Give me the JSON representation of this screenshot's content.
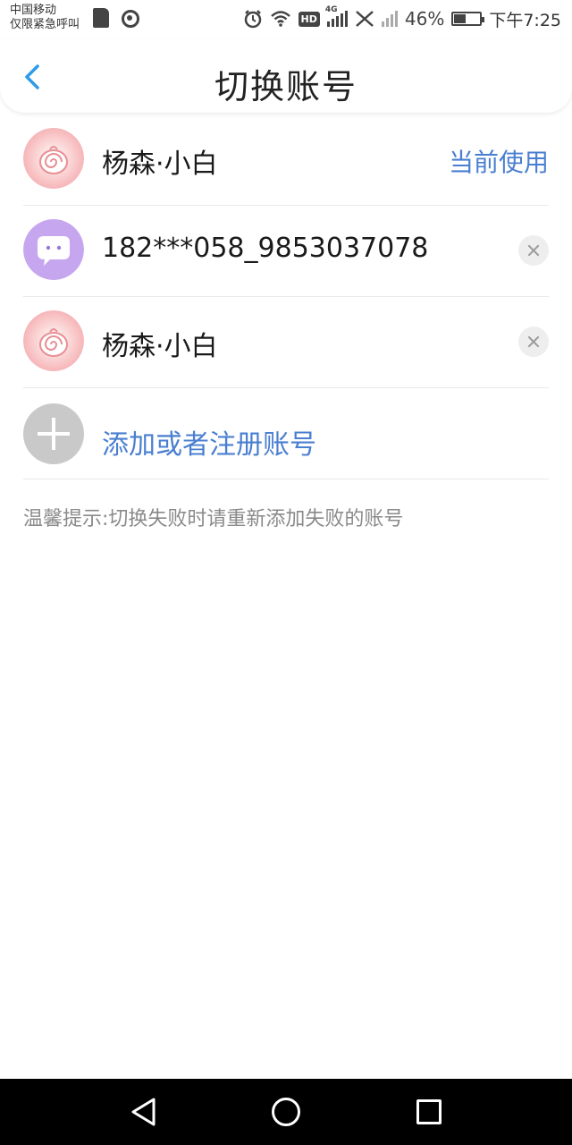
{
  "status_bar": {
    "carrier_line1": "中国移动",
    "carrier_line2": "仅限紧急呼叫",
    "network_badge": "HD",
    "network_type": "4G",
    "battery_percent": "46%",
    "battery_level": 0.46,
    "time": "下午7:25",
    "icons": [
      "sd-card-icon",
      "hotspot-icon",
      "alarm-icon",
      "wifi-icon",
      "hd-icon",
      "signal-icon",
      "no-signal-icon",
      "battery-icon"
    ]
  },
  "header": {
    "title": "切换账号",
    "back_icon": "chevron-left-icon"
  },
  "accounts": [
    {
      "name": "杨森·小白",
      "status": "当前使用",
      "avatar": "swirl-avatar"
    },
    {
      "name": "182***058_9853037078",
      "avatar": "chat-bubble-avatar"
    },
    {
      "name": "杨森·小白",
      "avatar": "swirl-avatar"
    }
  ],
  "add_account": {
    "label": "添加或者注册账号",
    "icon": "plus-icon"
  },
  "tip": "温馨提示:切换失败时请重新添加失败的账号",
  "colors": {
    "accent": "#4a7fd0",
    "back_arrow": "#2f9be8",
    "tip_text": "#8a8a8a",
    "nav_bar": "#000000"
  }
}
